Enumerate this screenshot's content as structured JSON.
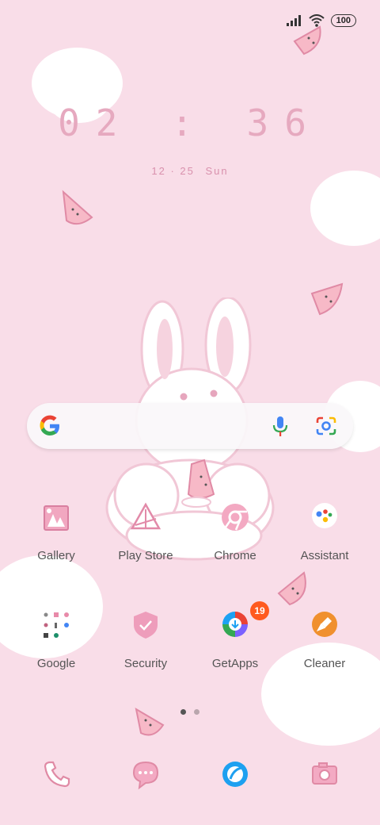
{
  "status_bar": {
    "battery": "100"
  },
  "clock": {
    "time": "02 : 36",
    "date": "12 · 25",
    "day": "Sun"
  },
  "apps": [
    {
      "label": "Gallery"
    },
    {
      "label": "Play Store"
    },
    {
      "label": "Chrome"
    },
    {
      "label": "Assistant"
    },
    {
      "label": "Google"
    },
    {
      "label": "Security"
    },
    {
      "label": "GetApps",
      "badge": "19"
    },
    {
      "label": "Cleaner"
    }
  ],
  "page_indicator": {
    "pages": 2,
    "current": 1
  },
  "dock": [
    "phone-icon",
    "messages-icon",
    "browser-icon",
    "camera-icon"
  ],
  "colors": {
    "background": "#f9dde8",
    "accent_pink": "#e9a1bd",
    "badge": "#ff5a1f"
  }
}
